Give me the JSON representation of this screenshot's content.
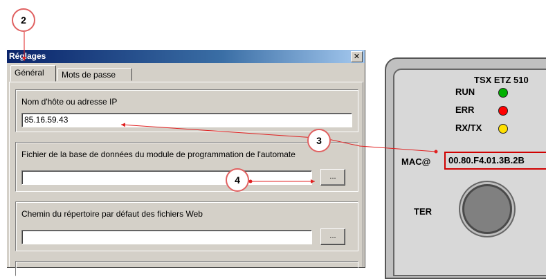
{
  "dialog": {
    "title": "Réglages",
    "close_glyph": "✕",
    "tabs": [
      {
        "label": "Général",
        "active": true
      },
      {
        "label": "Mots de passe",
        "active": false
      }
    ],
    "groups": [
      {
        "label": "Nom d'hôte ou adresse IP",
        "value": "85.16.59.43"
      },
      {
        "label": "Fichier de la base de données du module de programmation de l'automate",
        "value": "",
        "button": "..."
      },
      {
        "label": "Chemin du répertoire par défaut des fichiers Web",
        "value": "",
        "button": "..."
      }
    ]
  },
  "device": {
    "model": "TSX ETZ 510",
    "leds": [
      {
        "label": "RUN",
        "color": "#00b000"
      },
      {
        "label": "ERR",
        "color": "#ff0000"
      },
      {
        "label": "RX/TX",
        "color": "#ffe000"
      }
    ],
    "mac_label": "MAC@",
    "mac_value": "00.80.F4.01.3B.2B",
    "port_label": "TER"
  },
  "callouts": [
    "2",
    "3",
    "4"
  ],
  "colors": {
    "annotation": "#e02020",
    "titlebar": "#0a246a"
  }
}
